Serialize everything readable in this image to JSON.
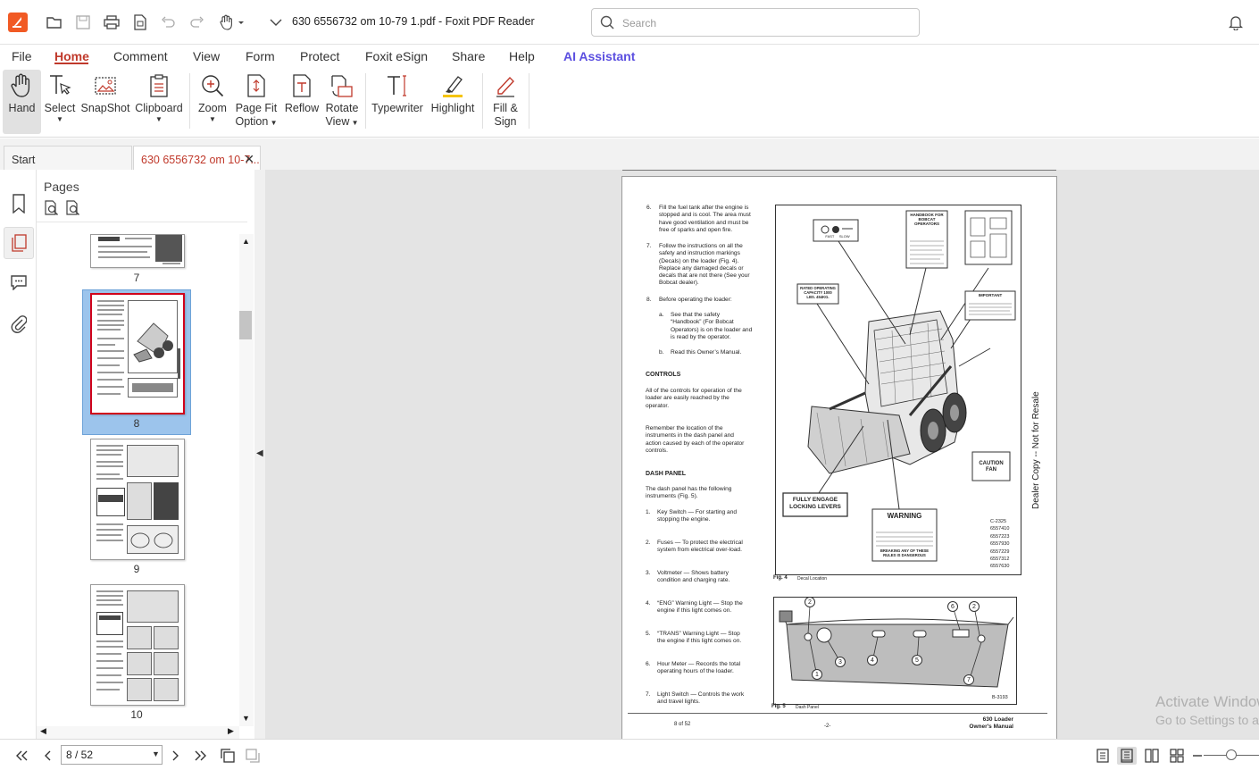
{
  "window": {
    "title": "630 6556732 om 10-79 1.pdf - Foxit PDF Reader"
  },
  "search": {
    "placeholder": "Search"
  },
  "menu": {
    "items": [
      "File",
      "Home",
      "Comment",
      "View",
      "Form",
      "Protect",
      "Foxit eSign",
      "Share",
      "Help",
      "AI Assistant"
    ],
    "active": "Home"
  },
  "ribbon": {
    "hand": "Hand",
    "select": "Select",
    "snapshot": "SnapShot",
    "clipboard": "Clipboard",
    "zoom": "Zoom",
    "page_fit_1": "Page Fit",
    "page_fit_2": "Option",
    "reflow": "Reflow",
    "rotate_1": "Rotate",
    "rotate_2": "View",
    "typewriter": "Typewriter",
    "highlight": "Highlight",
    "fill_sign_1": "Fill &",
    "fill_sign_2": "Sign"
  },
  "tabs": {
    "start": "Start",
    "document": "630 6556732 om 10-7..."
  },
  "pages_panel": {
    "title": "Pages",
    "thumbnails": [
      "7",
      "8",
      "9",
      "10"
    ],
    "selected": "8"
  },
  "document": {
    "items": [
      {
        "num": "6.",
        "text": [
          "Fill the fuel tank after the engine is",
          "stopped and is cool. The area must",
          "have good ventilation and must be",
          "free of sparks and open fire."
        ]
      },
      {
        "num": "7.",
        "text": [
          "Follow the instructions on all the",
          "safety and instruction markings",
          "(Decals) on the loader (Fig. 4).",
          "Replace any damaged decals or",
          "decals that are not there (See your",
          "Bobcat dealer)."
        ]
      },
      {
        "num": "8.",
        "text": [
          "Before operating the loader:"
        ]
      }
    ],
    "subitems": [
      {
        "num": "a.",
        "text": [
          "See that the safety",
          "“Handbook” (For Bobcat",
          "Operators) is on the loader and",
          "is read by the operator."
        ]
      },
      {
        "num": "b.",
        "text": [
          "Read this Owner’s Manual."
        ]
      }
    ],
    "controls_heading": "CONTROLS",
    "controls_text": [
      "All of the controls for operation of the",
      "loader are easily reached by the",
      "operator."
    ],
    "remember_text": [
      "Remember the location of the",
      "instruments in the dash panel and",
      "action caused by each of the operator",
      "controls."
    ],
    "dash_heading": "DASH PANEL",
    "dash_text": [
      "The dash panel has the following",
      "instruments (Fig. 5)."
    ],
    "instruments": [
      {
        "num": "1.",
        "text": [
          "Key Switch — For starting and",
          "stopping the engine."
        ]
      },
      {
        "num": "2.",
        "text": [
          "Fuses — To protect the electrical",
          "system from electrical over-load."
        ]
      },
      {
        "num": "3.",
        "text": [
          "Voltmeter — Shows battery",
          "condition and charging rate."
        ]
      },
      {
        "num": "4.",
        "text": [
          "“ENG” Warning Light — Stop the",
          "engine if this light comes on."
        ]
      },
      {
        "num": "5.",
        "text": [
          "“TRANS” Warning Light — Stop",
          "the engine if this light comes on."
        ]
      },
      {
        "num": "6.",
        "text": [
          "Hour Meter — Records the total",
          "operating hours of the loader."
        ]
      },
      {
        "num": "7.",
        "text": [
          "Light Switch — Controls the work",
          "and travel lights."
        ]
      }
    ],
    "fig4_label": "Fig. 4",
    "fig4_caption": "Decal Location",
    "fig5_label": "Fig. 5",
    "fig5_caption": "Dash Panel",
    "fig4_decals": {
      "rated": "RATED OPERATING CAPACITY 1000 LBS. 454KG.",
      "handbook": "HANDBOOK FOR BOBCAT OPERATORS",
      "caution": "CAUTION FAN",
      "fully_engage": "FULLY ENGAGE",
      "locking_levers": "LOCKING LEVERS",
      "warning": "WARNING",
      "breaking": "BREAKING ANY OF THESE RULES IS DANGEROUS",
      "important": "IMPORTANT",
      "part_numbers": [
        "C-2325",
        "6557410",
        "6557223",
        "6557930",
        "6557229",
        "6557312",
        "6557630"
      ]
    },
    "fig5_code": "B-3193",
    "fig5_callouts": [
      "1",
      "2",
      "3",
      "4",
      "5",
      "6",
      "2",
      "7"
    ],
    "footer_left": "8 of 52",
    "footer_center": "-2-",
    "footer_right_1": "630 Loader",
    "footer_right_2": "Owner's Manual",
    "side_text": "Dealer Copy -- Not for Resale"
  },
  "overlay": {
    "activate_1": "Activate Windows",
    "activate_2": "Go to Settings to activate Windows."
  },
  "status": {
    "page_value": "8 / 52"
  },
  "colors": {
    "accent": "#c0392b",
    "ai": "#5b4fe0",
    "selection": "#9cc4ec",
    "logo": "#f15a24"
  }
}
